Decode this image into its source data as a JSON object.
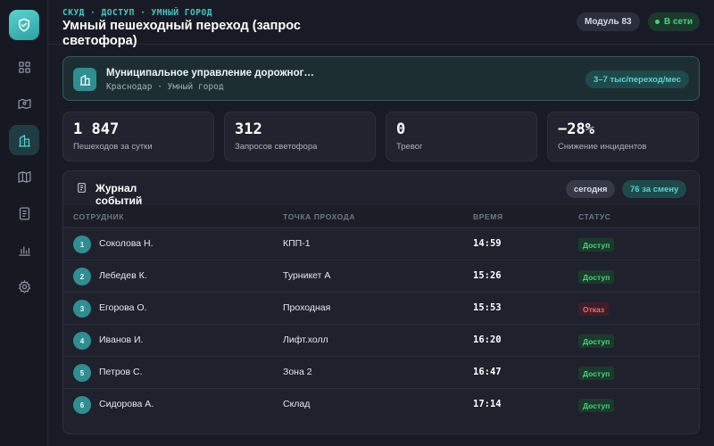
{
  "header": {
    "breadcrumb": "СКУД · ДОСТУП · УМНЫЙ ГОРОД",
    "title": "Умный пешеходный переход (запрос светофора)",
    "module": "Модуль 83",
    "status": "В сети"
  },
  "org": {
    "name": "Муниципальное управление дорожног…",
    "subtitle": "Краснодар · Умный город",
    "rate": "3–7 тыс/переход/мес"
  },
  "stats": [
    {
      "value": "1 847",
      "label": "Пешеходов за сутки"
    },
    {
      "value": "312",
      "label": "Запросов светофора"
    },
    {
      "value": "0",
      "label": "Тревог"
    },
    {
      "value": "−28%",
      "label": "Снижение инцидентов"
    }
  ],
  "log": {
    "title": "Журнал событий",
    "filter_today": "сегодня",
    "shift_count": "76 за смену",
    "columns": [
      "СОТРУДНИК",
      "ТОЧКА ПРОХОДА",
      "ВРЕМЯ",
      "СТАТУС"
    ],
    "rows": [
      {
        "n": "1",
        "name": "Соколова Н.",
        "point": "КПП-1",
        "time": "14:59",
        "status": "Доступ",
        "kind": "ok"
      },
      {
        "n": "2",
        "name": "Лебедев К.",
        "point": "Турникет А",
        "time": "15:26",
        "status": "Доступ",
        "kind": "ok"
      },
      {
        "n": "3",
        "name": "Егорова О.",
        "point": "Проходная",
        "time": "15:53",
        "status": "Отказ",
        "kind": "deny"
      },
      {
        "n": "4",
        "name": "Иванов И.",
        "point": "Лифт.холл",
        "time": "16:20",
        "status": "Доступ",
        "kind": "ok"
      },
      {
        "n": "5",
        "name": "Петров С.",
        "point": "Зона 2",
        "time": "16:47",
        "status": "Доступ",
        "kind": "ok"
      },
      {
        "n": "6",
        "name": "Сидорова А.",
        "point": "Склад",
        "time": "17:14",
        "status": "Доступ",
        "kind": "ok"
      }
    ]
  },
  "colors": {
    "accent": "#49c9c3",
    "success": "#43d67a",
    "danger": "#f06a78",
    "background": "#181b25"
  },
  "icons": {
    "logo": "shield-check-icon",
    "nav": [
      "dashboard-icon",
      "map-pin-icon",
      "building-icon",
      "map-icon",
      "document-icon",
      "bar-chart-icon",
      "gear-icon"
    ],
    "org": "building-icon",
    "log": "document-icon"
  }
}
